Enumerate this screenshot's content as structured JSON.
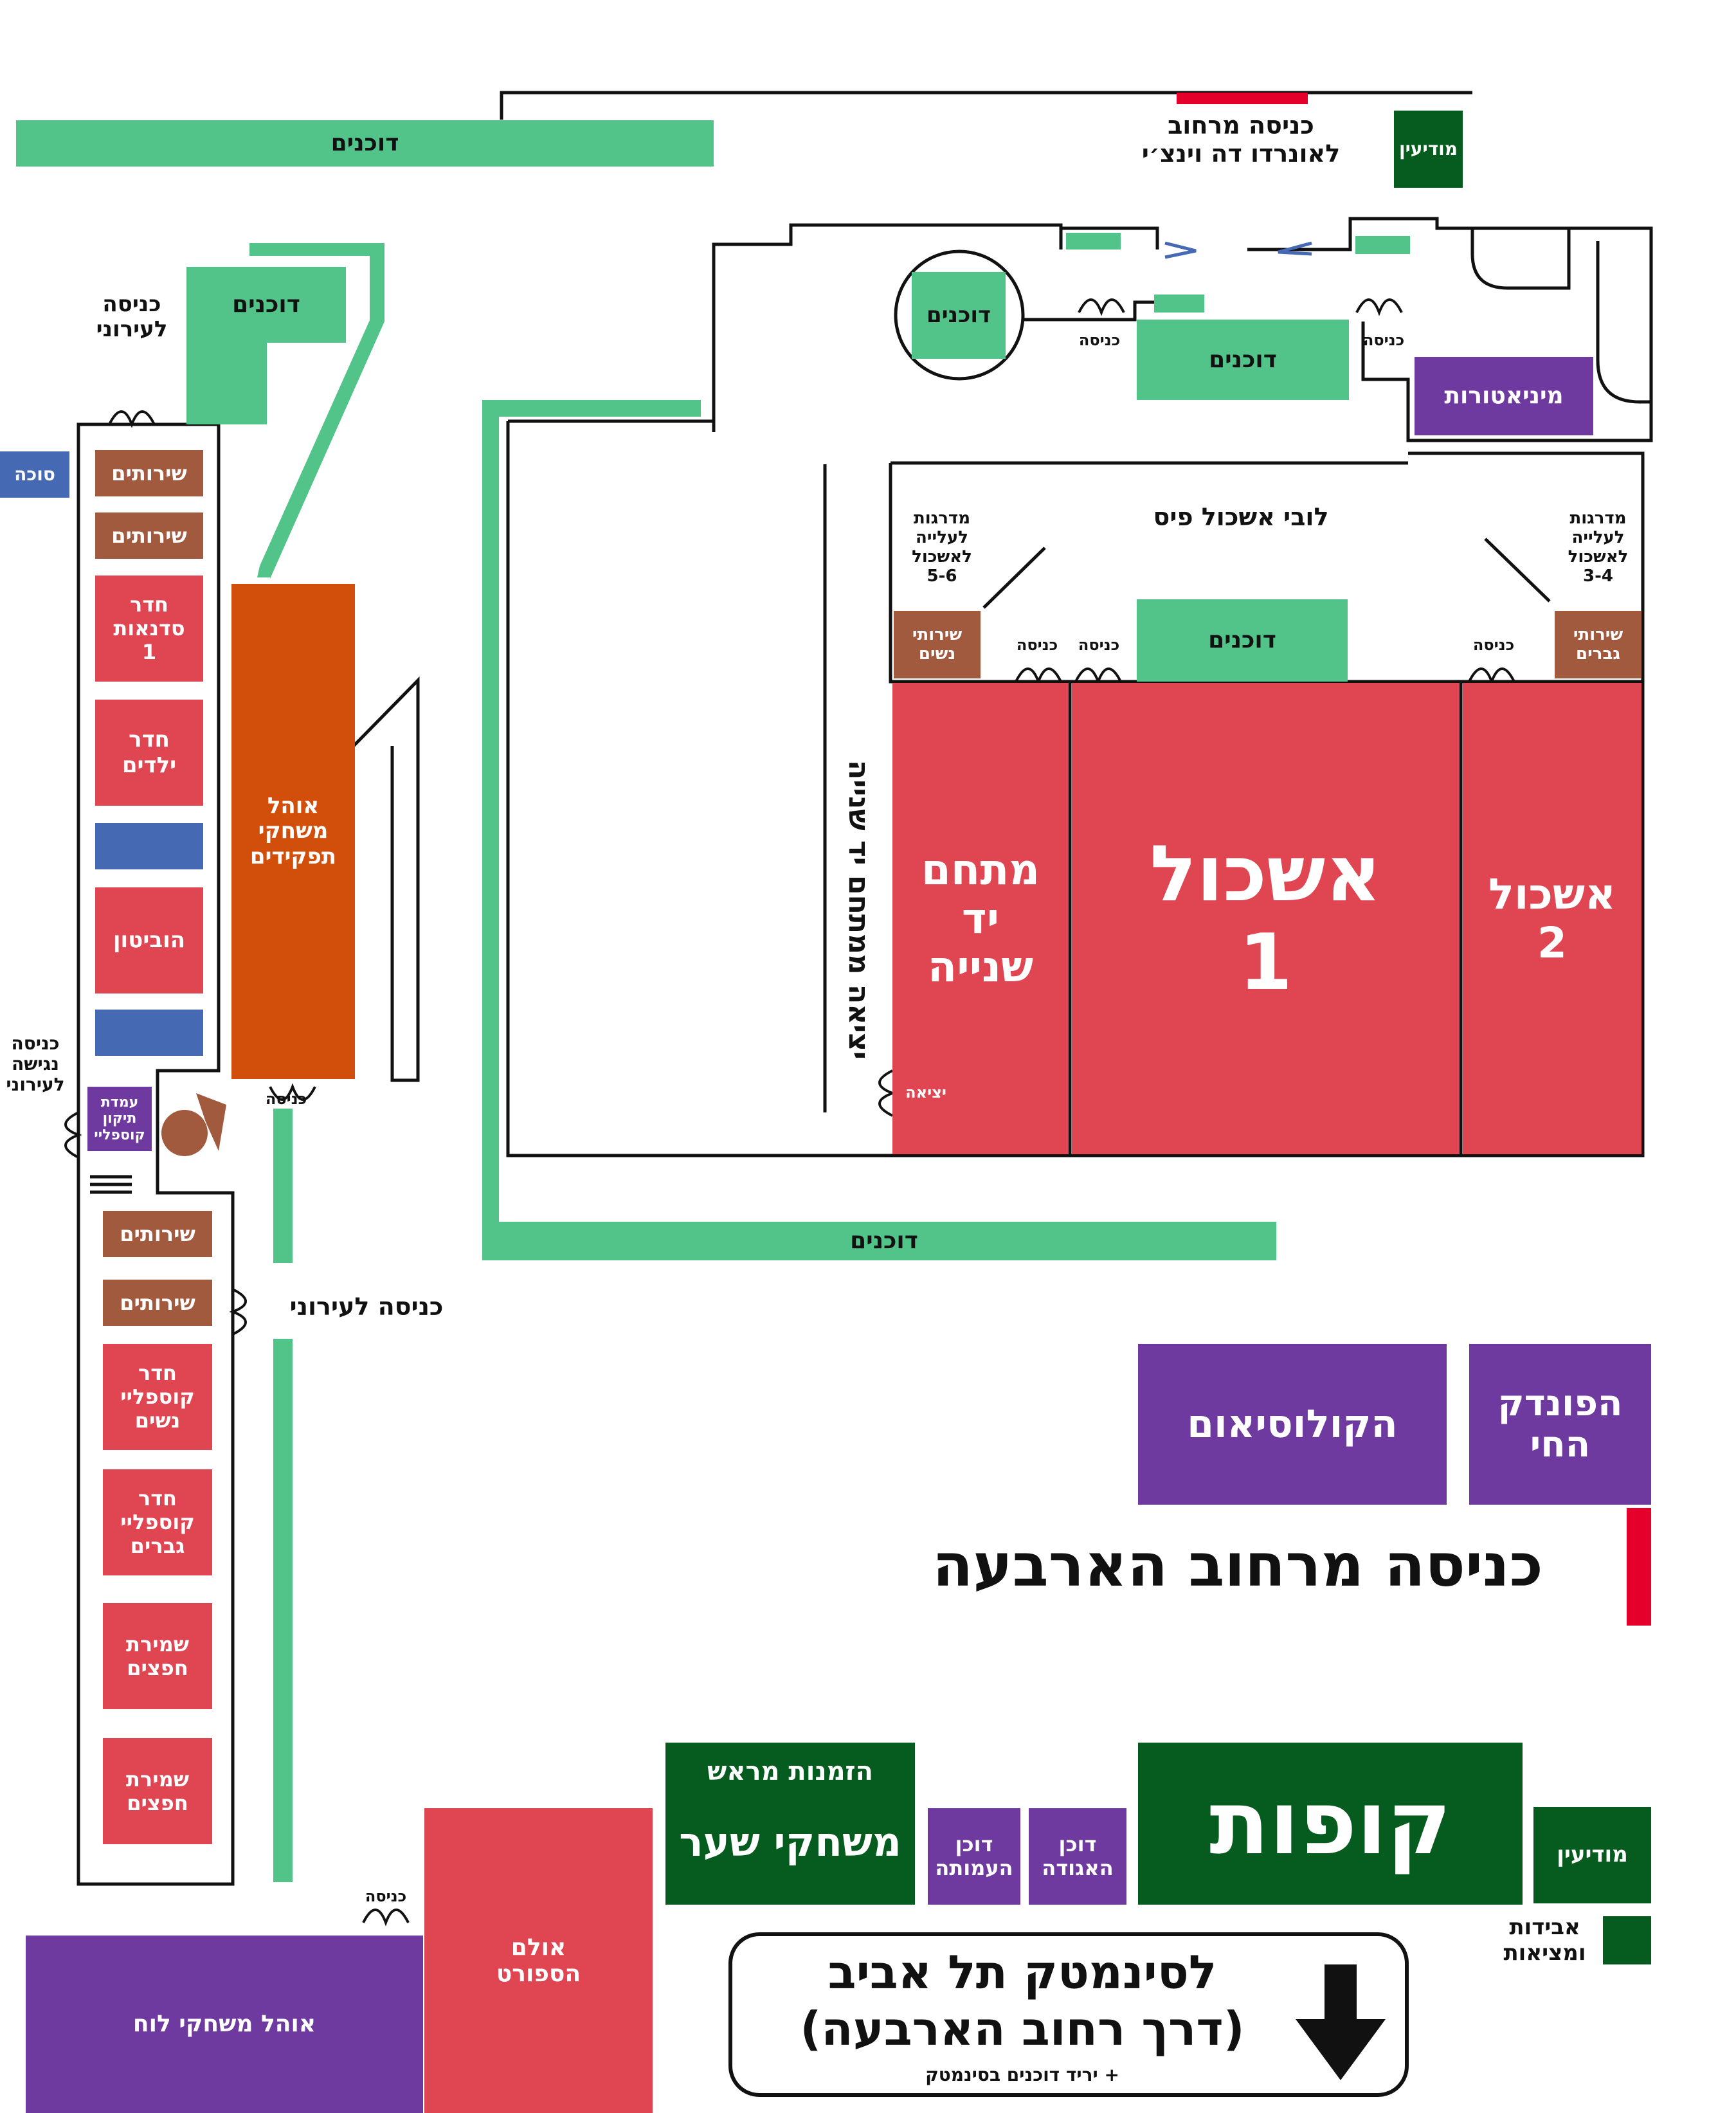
{
  "colors": {
    "booths": "#52c48a",
    "restrooms": "#a25a3f",
    "halls": "#e04552",
    "attractions": "#6f3aa0",
    "info": "#065b1e",
    "no_entry": "#4669b4",
    "roleplay_tent": "#d14e0b",
    "entrance_marker": "#e4002b"
  },
  "icons": [
    "door-icon",
    "no-entry-icon",
    "arrow-down-icon",
    "cosplay-repair-logo",
    "stairs-icon"
  ],
  "labels": {
    "booths": "דוכנים",
    "entrance": "כניסה",
    "exit": "יציאה",
    "restrooms": "שירותים",
    "leonardo_entrance": "כניסה מרחוב\nלאונרדו דה וינצ׳י",
    "info": "מודיעין",
    "residents_entrance_top": "כניסה\nלעירוני",
    "residents_entrance": "כניסה לעירוני",
    "accessible_entrance": "כניסה\nנגישה\nלעירוני",
    "sukkah": "סוכה",
    "workshop_room": "חדר\nסדנאות\n1",
    "kids_room": "חדר\nילדים",
    "hobbiton": "הוביטון",
    "roleplay_tent": "אוהל\nמשחקי\nתפקידים",
    "cosplay_repair": "עמדת\nתיקון\nקוספליי",
    "cosplay_women": "חדר\nקוספליי\nנשים",
    "cosplay_men": "חדר\nקוספליי\nגברים",
    "storage": "שמירת\nחפצים",
    "miniatures": "מיניאטורות",
    "lobby": "לובי אשכול פיס",
    "stairs_56": "מדרגות\nלעלייה\nלאשכול\n5-6",
    "stairs_34": "מדרגות\nלעלייה\nלאשכול\n3-4",
    "women_restrooms": "שירותי\nנשים",
    "men_restrooms": "שירותי\nגברים",
    "yad_shniya_compound": "מתחם\nיד\nשנייה",
    "eshkol_1": "אשכול\n1",
    "eshkol_2": "אשכול\n2",
    "yad_shniya_exit": "יציאה ממתחם יד שנייה",
    "colosseum": "הקולוסיאום",
    "living_inn": "הפונדק\nהחי",
    "arbaa_entrance": "כניסה מרחוב הארבעה",
    "preorders": "הזמנות מראש",
    "gamers_gate": "משחקי שער",
    "amuta_booth": "דוכן\nהעמותה",
    "aguda_booth": "דוכן\nהאגודה",
    "box_office": "קופות",
    "lost_found": "אבידות\nומציאות",
    "sport_hall": "אולם\nהספורט",
    "board_games_tent": "אוהל משחקי לוח",
    "cinematheque_line1": "לסינמטק תל אביב",
    "cinematheque_line2": "(דרך רחוב הארבעה)",
    "cinematheque_note": "+ יריד דוכנים בסינמטק"
  }
}
